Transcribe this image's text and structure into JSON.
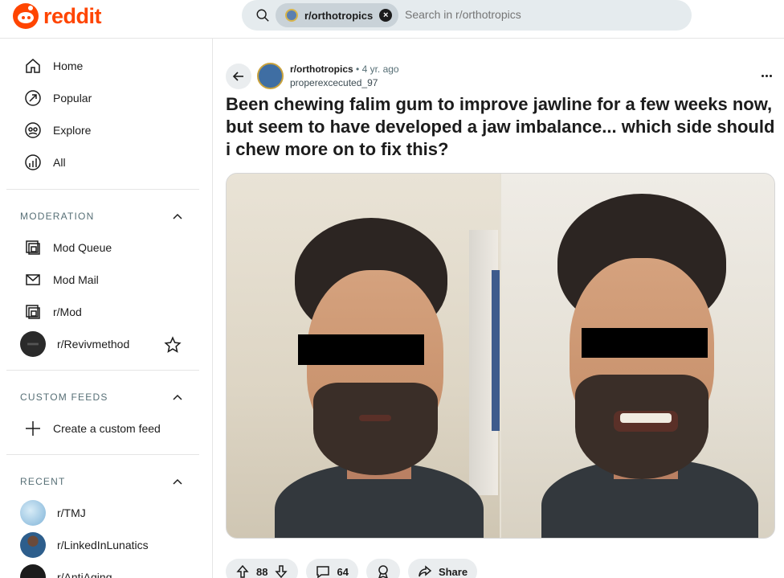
{
  "header": {
    "logo_text": "reddit",
    "search": {
      "chip_label": "r/orthotropics",
      "placeholder": "Search in r/orthotropics"
    }
  },
  "sidebar": {
    "nav": [
      {
        "label": "Home",
        "icon": "home-icon"
      },
      {
        "label": "Popular",
        "icon": "popular-icon"
      },
      {
        "label": "Explore",
        "icon": "explore-icon"
      },
      {
        "label": "All",
        "icon": "all-icon"
      }
    ],
    "moderation": {
      "heading": "MODERATION",
      "items": [
        {
          "label": "Mod Queue",
          "icon": "mod-queue-icon"
        },
        {
          "label": "Mod Mail",
          "icon": "mod-mail-icon"
        },
        {
          "label": "r/Mod",
          "icon": "mod-icon"
        },
        {
          "label": "r/Revivmethod",
          "icon": "subreddit-avatar"
        }
      ]
    },
    "custom_feeds": {
      "heading": "CUSTOM FEEDS",
      "items": [
        {
          "label": "Create a custom feed",
          "icon": "plus-icon"
        }
      ]
    },
    "recent": {
      "heading": "RECENT",
      "items": [
        {
          "label": "r/TMJ"
        },
        {
          "label": "r/LinkedInLunatics"
        },
        {
          "label": "r/AntiAging"
        }
      ]
    }
  },
  "post": {
    "subreddit": "r/orthotropics",
    "separator": "•",
    "age": "4 yr. ago",
    "author": "properexcecuted_97",
    "title": "Been chewing falim gum to improve jawline for a few weeks now, but seem to have developed a jaw imbalance... which side should i chew more on to fix this?",
    "actions": {
      "votes": "88",
      "comments": "64",
      "share_label": "Share"
    }
  },
  "colors": {
    "brand": "#ff4500",
    "search_bg": "#e5ebee",
    "pill_bg": "#eaedef",
    "muted_text": "#576f76"
  }
}
